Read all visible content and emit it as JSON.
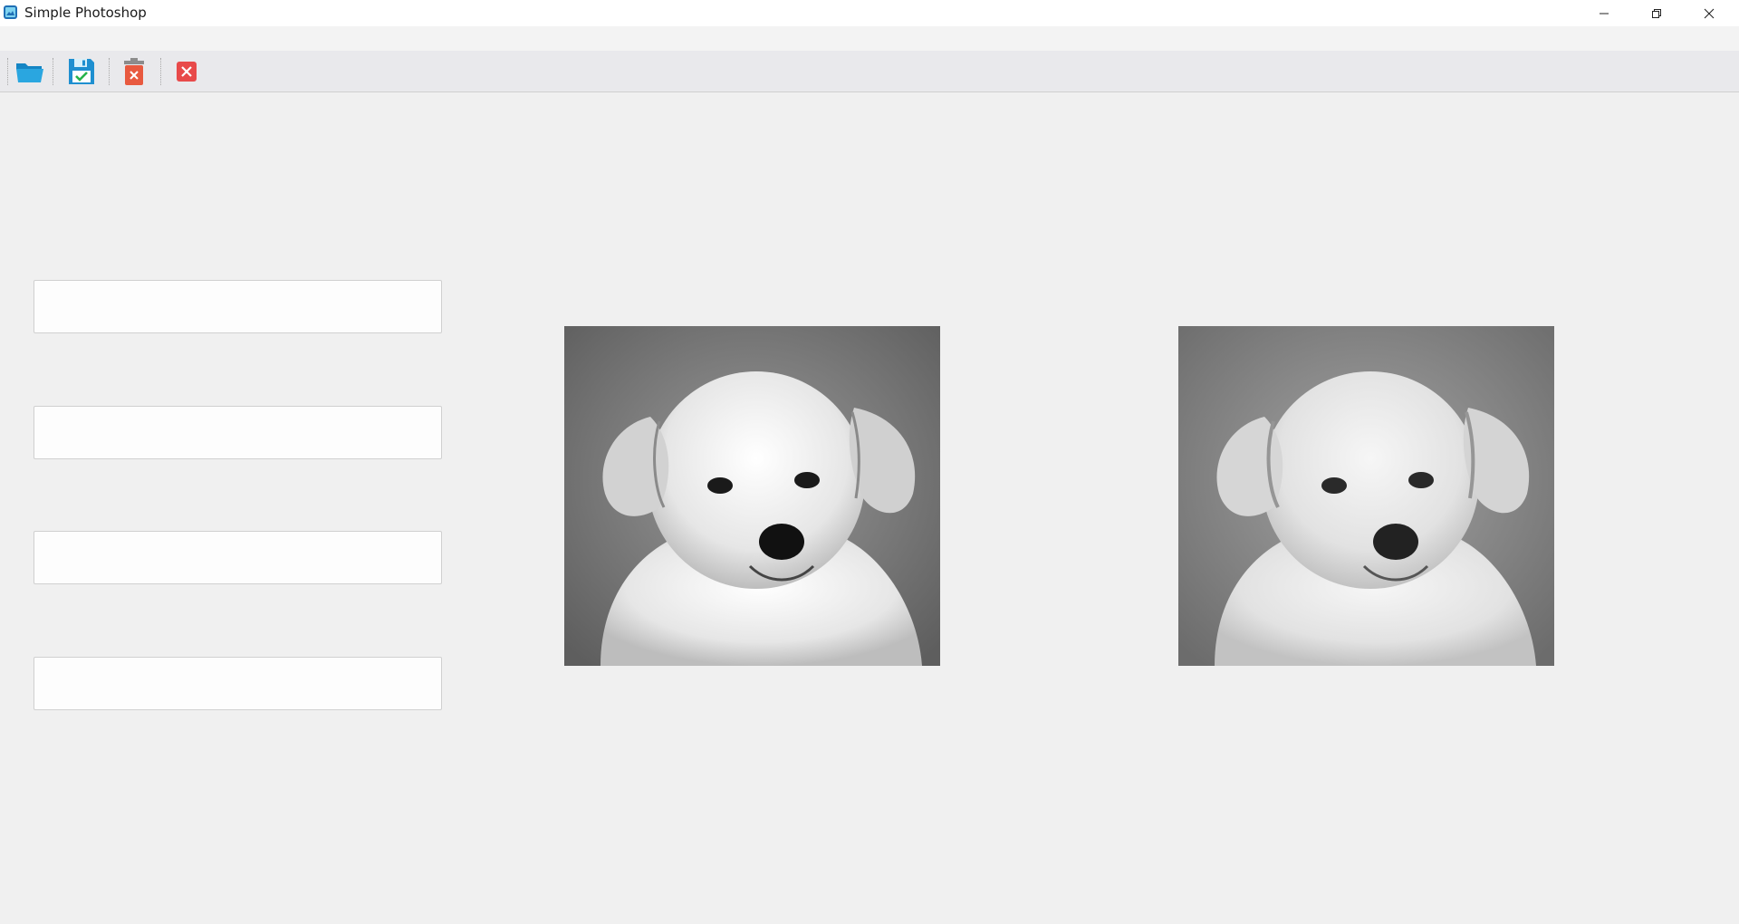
{
  "window": {
    "title": "Simple Photoshop",
    "controls": [
      "minimize-icon",
      "restore-icon",
      "close-icon"
    ]
  },
  "toolbar": {
    "tools": [
      {
        "icon": "open-folder-icon"
      },
      {
        "icon": "save-icon"
      },
      {
        "icon": "delete-icon"
      },
      {
        "icon": "close-image-icon"
      }
    ]
  },
  "images": {
    "original": {
      "icon": "puppy-photo-original",
      "tone": "grayscale"
    },
    "result": {
      "icon": "puppy-photo-result",
      "tone": "grayscale, softened"
    }
  },
  "colors": {
    "background": "#f0f0f0",
    "toolbar": "#e9e9ec",
    "button": "#fdfdfd",
    "button_border": "#d0d0d0",
    "accent_blue": "#1e9bd7",
    "close_red": "#e84a4a"
  }
}
